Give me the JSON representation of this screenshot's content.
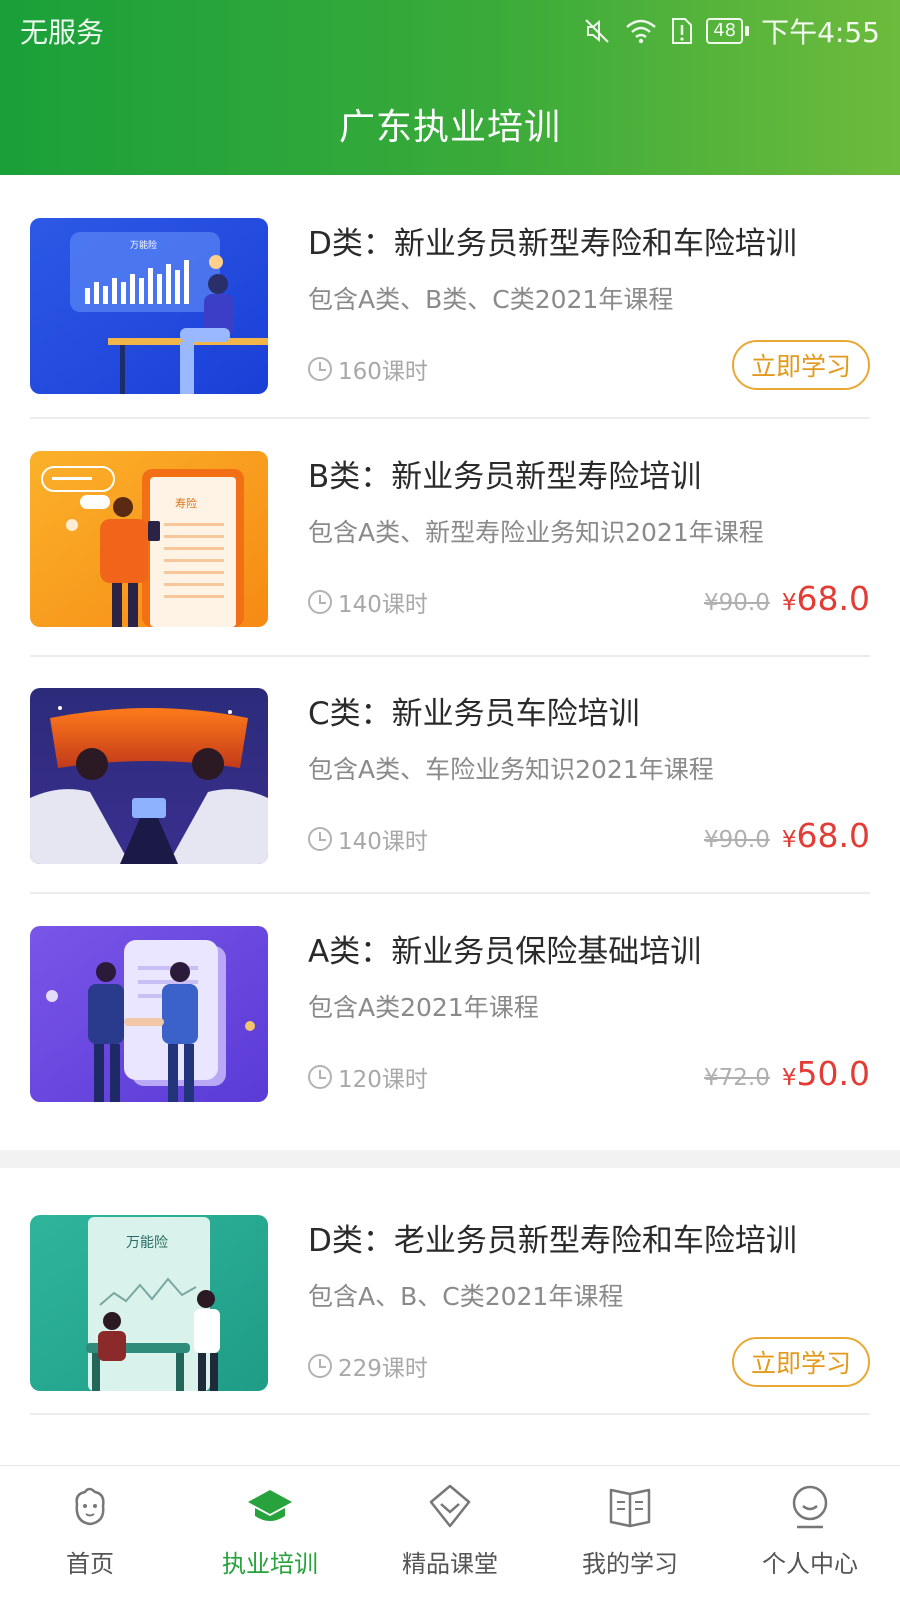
{
  "status_bar": {
    "carrier": "无服务",
    "battery": "48",
    "time": "下午4:55"
  },
  "header": {
    "title": "广东执业培训"
  },
  "courses": [
    {
      "name": "D类：新业务员新型寿险和车险培训",
      "description": "包含A类、B类、C类2021年课程",
      "hours": "160课时",
      "action": "立即学习",
      "thumb_label": "万能险"
    },
    {
      "name": "B类：新业务员新型寿险培训",
      "description": "包含A类、新型寿险业务知识2021年课程",
      "hours": "140课时",
      "original_price": "¥90.0",
      "currency": "¥",
      "sale_price": "68.0",
      "thumb_label": "寿险"
    },
    {
      "name": "C类：新业务员车险培训",
      "description": "包含A类、车险业务知识2021年课程",
      "hours": "140课时",
      "original_price": "¥90.0",
      "currency": "¥",
      "sale_price": "68.0"
    },
    {
      "name": "A类：新业务员保险基础培训",
      "description": "包含A类2021年课程",
      "hours": "120课时",
      "original_price": "¥72.0",
      "currency": "¥",
      "sale_price": "50.0"
    },
    {
      "name": "D类：老业务员新型寿险和车险培训",
      "description": "包含A、B、C类2021年课程",
      "hours": "229课时",
      "action": "立即学习",
      "thumb_label": "万能险"
    }
  ],
  "tabs": [
    {
      "label": "首页",
      "icon": "home-icon",
      "active": false
    },
    {
      "label": "执业培训",
      "icon": "training-icon",
      "active": true
    },
    {
      "label": "精品课堂",
      "icon": "diamond-icon",
      "active": false
    },
    {
      "label": "我的学习",
      "icon": "book-icon",
      "active": false
    },
    {
      "label": "个人中心",
      "icon": "profile-icon",
      "active": false
    }
  ],
  "colors": {
    "brand_green": "#2aa23a",
    "price_red": "#e23c35",
    "button_orange": "#e9a834"
  }
}
